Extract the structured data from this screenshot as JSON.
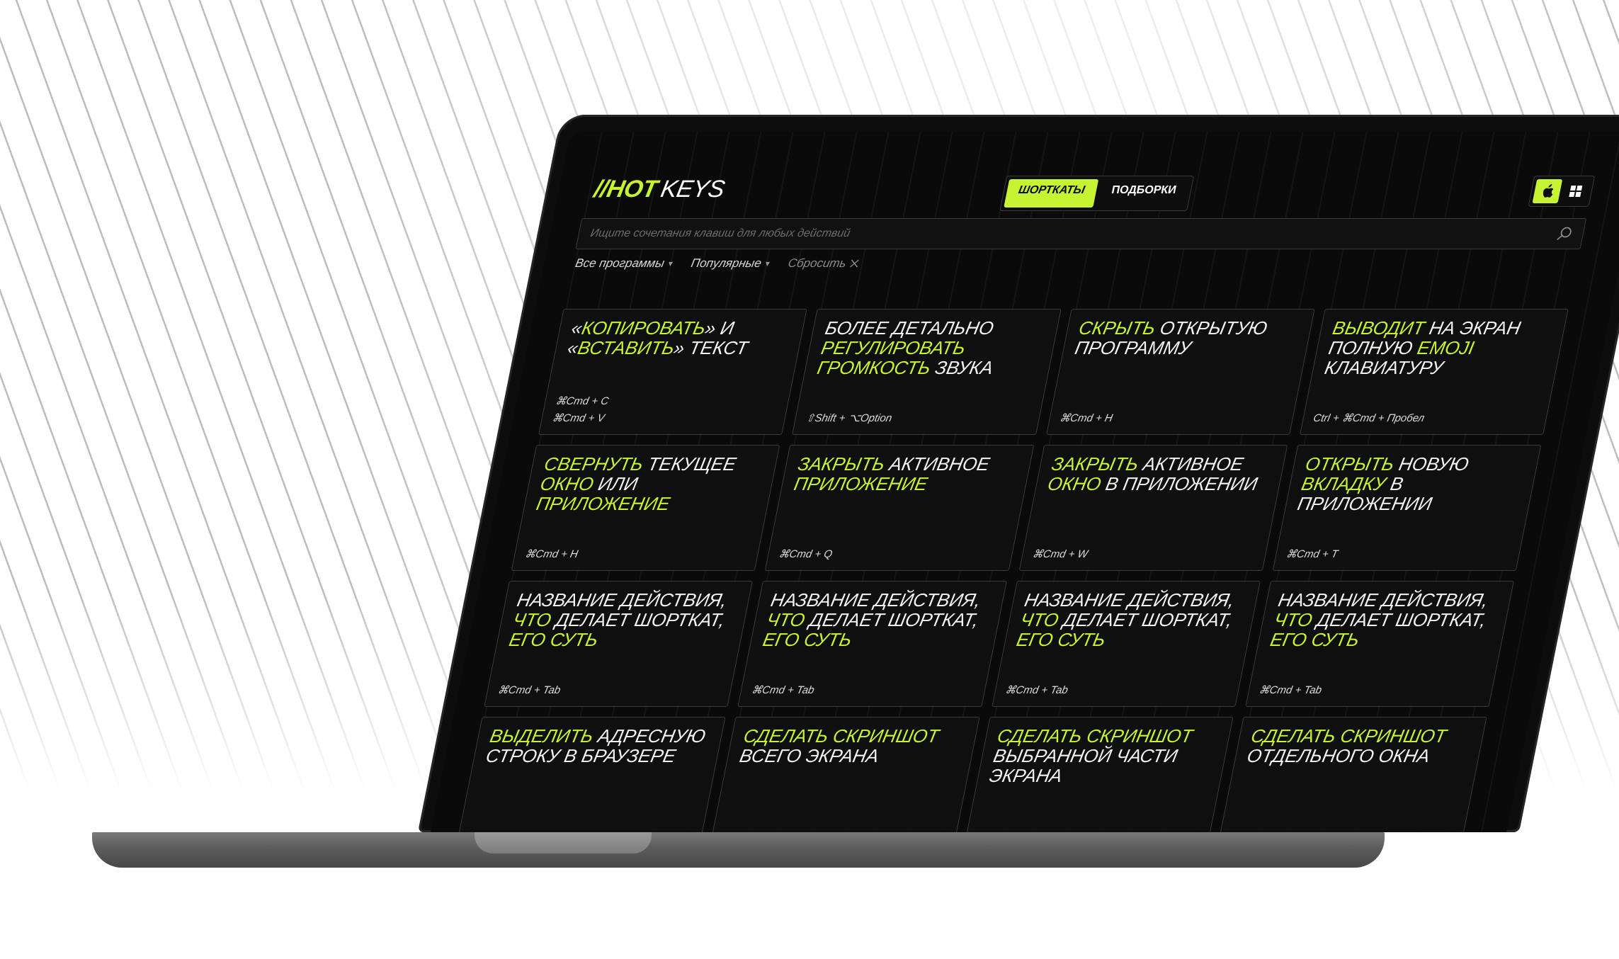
{
  "app": {
    "logo_hash": "//",
    "logo_hot": "HOT",
    "logo_keys": "KEYS"
  },
  "tabs": [
    {
      "label": "ШОРТКАТЫ",
      "active": true
    },
    {
      "label": "ПОДБОРКИ",
      "active": false
    }
  ],
  "os_switch": [
    {
      "icon": "apple-icon",
      "active": true
    },
    {
      "icon": "windows-icon",
      "active": false
    }
  ],
  "search": {
    "placeholder": "Ищите сочетания клавиш для любых действий",
    "value": ""
  },
  "filters": {
    "all_programs": "Все программы",
    "popular": "Популярные",
    "reset": "Сбросить"
  },
  "colors": {
    "accent": "#c6f432",
    "background": "#0a0a0a",
    "card_border": "#3b3b3b",
    "text": "#f2f2f2"
  },
  "cards": [
    {
      "title": [
        [
          "«",
          false
        ],
        [
          "КОПИРОВАТЬ",
          true
        ],
        [
          "» И «",
          false
        ],
        [
          "ВСТАВИТЬ",
          true
        ],
        [
          "» ТЕКСТ",
          false
        ]
      ],
      "keys": [
        "⌘Cmd + C",
        "⌘Cmd + V"
      ]
    },
    {
      "title": [
        [
          "БОЛЕЕ ДЕТАЛЬНО ",
          false
        ],
        [
          "РЕГУЛИРОВАТЬ ГРОМКОСТЬ",
          true
        ],
        [
          " ЗВУКА",
          false
        ]
      ],
      "keys": [
        "⇧Shift  + ⌥Option"
      ]
    },
    {
      "title": [
        [
          "СКРЫТЬ",
          true
        ],
        [
          " ОТКРЫТУЮ ПРОГРАММУ",
          false
        ]
      ],
      "keys": [
        "⌘Cmd + H"
      ]
    },
    {
      "title": [
        [
          "ВЫВОДИТ",
          true
        ],
        [
          " НА ЭКРАН ПОЛНУЮ ",
          false
        ],
        [
          "EMOJI",
          true
        ],
        [
          " КЛАВИАТУРУ",
          false
        ]
      ],
      "keys": [
        "Ctrl + ⌘Cmd + Пробел"
      ]
    },
    {
      "title": [
        [
          "СВЕРНУТЬ",
          true
        ],
        [
          " ТЕКУЩЕЕ ",
          false
        ],
        [
          "ОКНО",
          true
        ],
        [
          " ИЛИ ",
          false
        ],
        [
          "ПРИЛОЖЕНИЕ",
          true
        ]
      ],
      "keys": [
        "⌘Cmd + H"
      ]
    },
    {
      "title": [
        [
          "ЗАКРЫТЬ",
          true
        ],
        [
          " АКТИВНОЕ ",
          false
        ],
        [
          "ПРИЛОЖЕНИЕ",
          true
        ]
      ],
      "keys": [
        "⌘Cmd + Q"
      ]
    },
    {
      "title": [
        [
          "ЗАКРЫТЬ",
          true
        ],
        [
          " АКТИВНОЕ ",
          false
        ],
        [
          "ОКНО",
          true
        ],
        [
          " В ПРИЛОЖЕНИИ",
          false
        ]
      ],
      "keys": [
        "⌘Cmd + W"
      ]
    },
    {
      "title": [
        [
          "ОТКРЫТЬ",
          true
        ],
        [
          " НОВУЮ ",
          false
        ],
        [
          "ВКЛАДКУ",
          true
        ],
        [
          " В ПРИЛОЖЕНИИ",
          false
        ]
      ],
      "keys": [
        "⌘Cmd + T"
      ]
    },
    {
      "title": [
        [
          "НАЗВАНИЕ ДЕЙСТВИЯ, ",
          false
        ],
        [
          "ЧТО",
          true
        ],
        [
          " ДЕЛАЕТ ШОРТКАТ, ",
          false
        ],
        [
          "ЕГО СУТЬ",
          true
        ]
      ],
      "keys": [
        "⌘Cmd + Tab"
      ]
    },
    {
      "title": [
        [
          "НАЗВАНИЕ ДЕЙСТВИЯ, ",
          false
        ],
        [
          "ЧТО",
          true
        ],
        [
          " ДЕЛАЕТ ШОРТКАТ, ",
          false
        ],
        [
          "ЕГО СУТЬ",
          true
        ]
      ],
      "keys": [
        "⌘Cmd + Tab"
      ]
    },
    {
      "title": [
        [
          "НАЗВАНИЕ ДЕЙСТВИЯ, ",
          false
        ],
        [
          "ЧТО",
          true
        ],
        [
          " ДЕЛАЕТ ШОРТКАТ, ",
          false
        ],
        [
          "ЕГО СУТЬ",
          true
        ]
      ],
      "keys": [
        "⌘Cmd + Tab"
      ]
    },
    {
      "title": [
        [
          "НАЗВАНИЕ ДЕЙСТВИЯ, ",
          false
        ],
        [
          "ЧТО",
          true
        ],
        [
          " ДЕЛАЕТ ШОРТКАТ, ",
          false
        ],
        [
          "ЕГО СУТЬ",
          true
        ]
      ],
      "keys": [
        "⌘Cmd + Tab"
      ]
    },
    {
      "title": [
        [
          "ВЫДЕЛИТЬ",
          true
        ],
        [
          " АДРЕСНУЮ СТРОКУ В БРАУЗЕРЕ",
          false
        ]
      ],
      "keys": []
    },
    {
      "title": [
        [
          "СДЕЛАТЬ СКРИНШОТ",
          true
        ],
        [
          " ВСЕГО ЭКРАНА",
          false
        ]
      ],
      "keys": []
    },
    {
      "title": [
        [
          "СДЕЛАТЬ СКРИНШОТ",
          true
        ],
        [
          " ВЫБРАННОЙ ЧАСТИ ЭКРАНА",
          false
        ]
      ],
      "keys": []
    },
    {
      "title": [
        [
          "СДЕЛАТЬ СКРИНШОТ",
          true
        ],
        [
          " ОТДЕЛЬНОГО ОКНА",
          false
        ]
      ],
      "keys": []
    }
  ]
}
